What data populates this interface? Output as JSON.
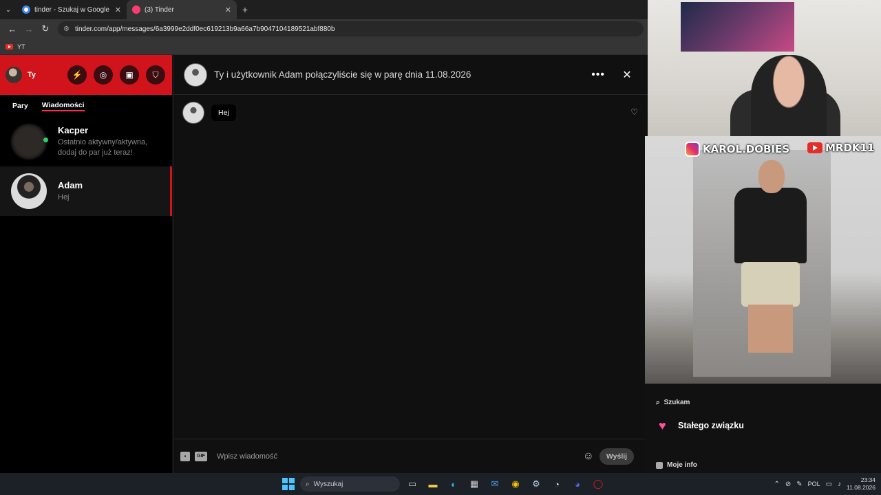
{
  "browser": {
    "tabs": [
      {
        "title": "tinder - Szukaj w Google",
        "favicon_color": "#4285f4"
      },
      {
        "title": "(3) Tinder",
        "favicon_color": "#fe3c72"
      }
    ],
    "url": "tinder.com/app/messages/6a3999e2ddf0ec619213b9a66a7b9047104189521abf880b",
    "bookmarks": [
      {
        "label": "YT"
      }
    ]
  },
  "sidebar": {
    "me_label": "Ty",
    "tabs": [
      "Pary",
      "Wiadomości"
    ],
    "conversations": [
      {
        "name": "Kacper",
        "preview": "Ostatnio aktywny/aktywna, dodaj do par już teraz!"
      },
      {
        "name": "Adam",
        "preview": "Hej"
      }
    ]
  },
  "chat": {
    "match_text": "Ty i użytkownik Adam połączyliście się w parę dnia 11.08.2026",
    "messages": [
      {
        "text": "Hej"
      }
    ],
    "composer": {
      "gif_label": "GIF",
      "placeholder": "Wpisz wiadomość",
      "send_label": "Wyślij"
    }
  },
  "overlay": {
    "instagram": "KAROL.DOBIES",
    "youtube": "MRDK11",
    "looking_for_label": "Szukam",
    "looking_for_value": "Stałego związku",
    "info_label": "Moje info"
  },
  "taskbar": {
    "search_placeholder": "Wyszukaj",
    "language": "POL",
    "time": "23:34",
    "date": "11.08.2026"
  },
  "colors": {
    "tinder_red": "#d1131c",
    "online": "#27d46b",
    "accent_pink": "#ff2d55"
  }
}
